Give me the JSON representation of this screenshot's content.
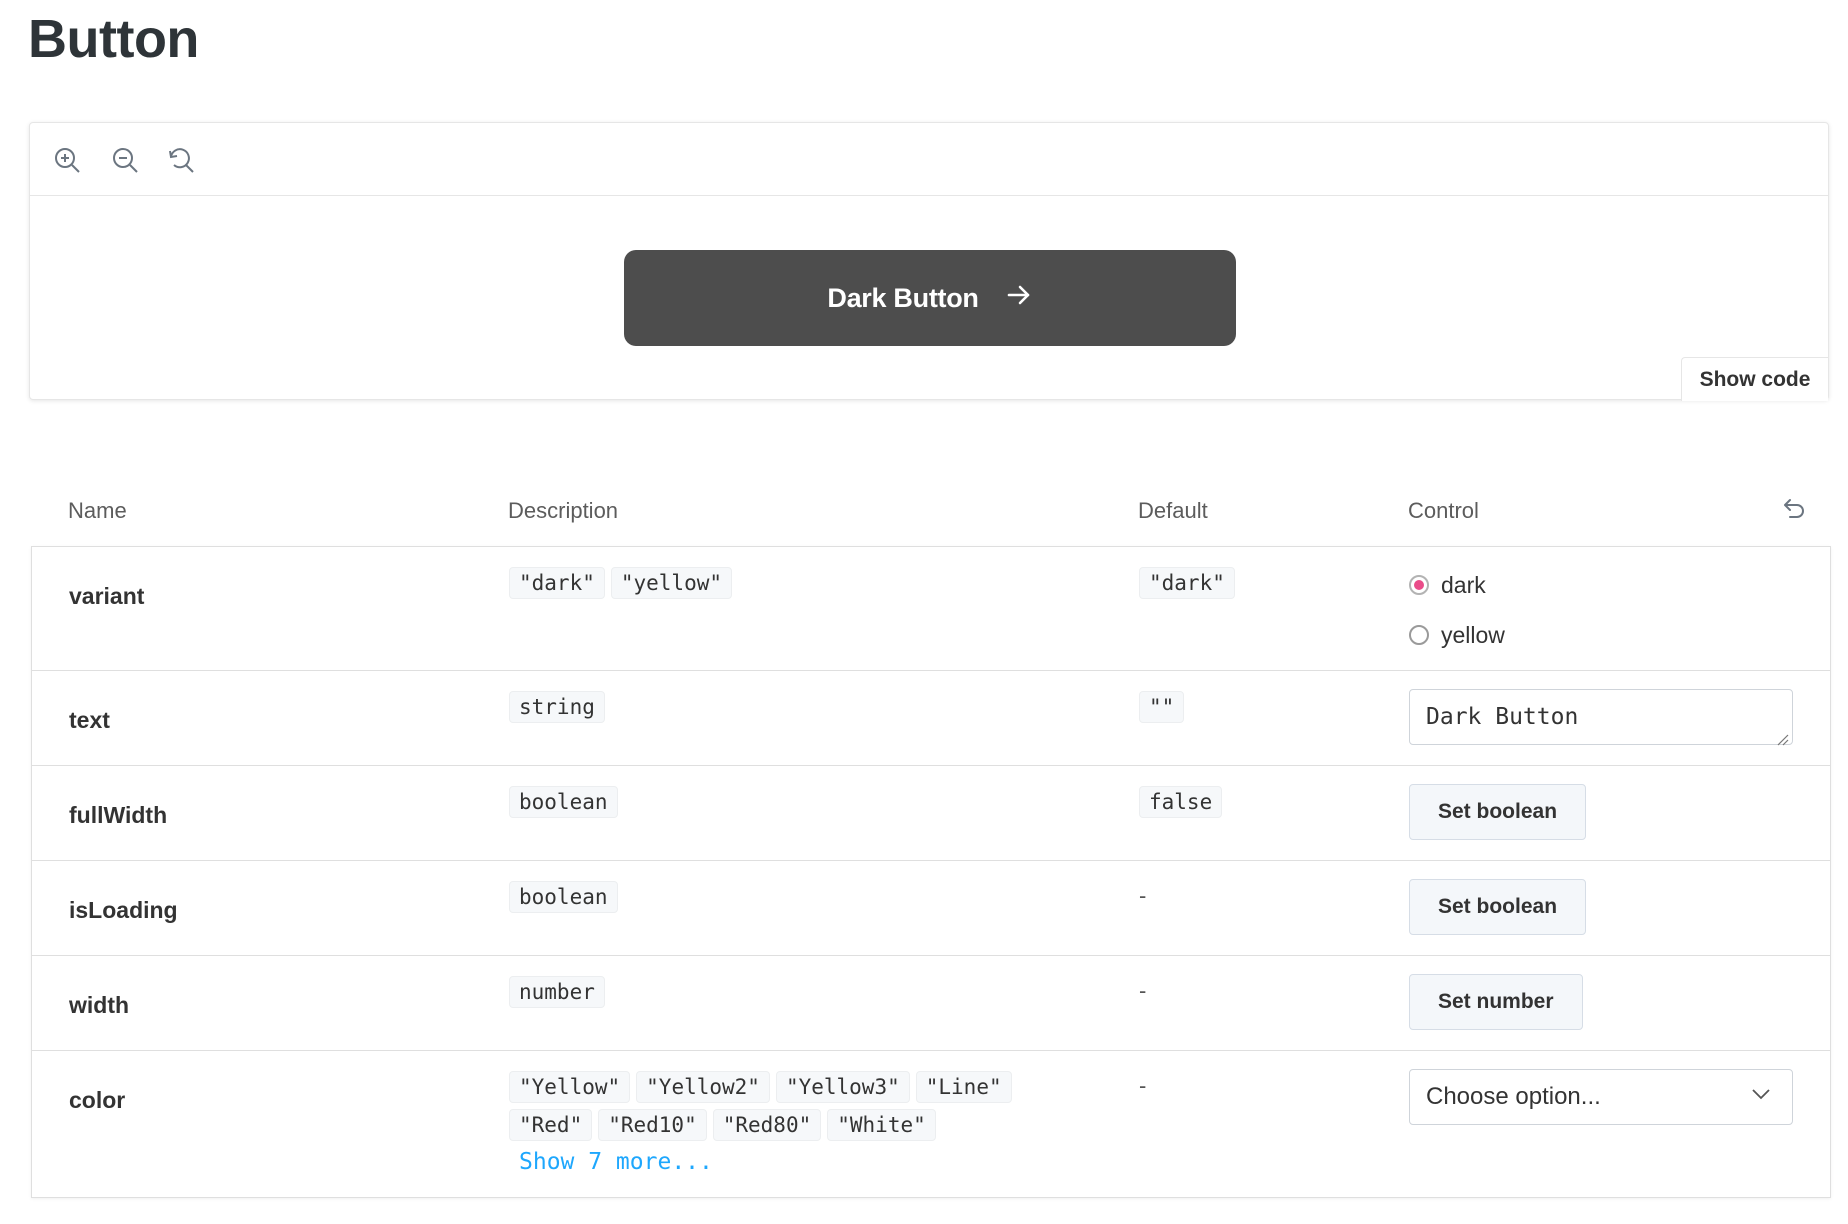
{
  "page": {
    "title": "Button"
  },
  "toolbar": {
    "icons": [
      "zoom-in-icon",
      "zoom-out-icon",
      "zoom-reset-icon"
    ]
  },
  "preview": {
    "button_label": "Dark Button",
    "button_icon": "arrow-right-icon",
    "button_color": "#4d4d4d",
    "show_code_label": "Show code"
  },
  "table": {
    "headers": {
      "name": "Name",
      "description": "Description",
      "default": "Default",
      "control": "Control"
    },
    "reset_icon": "undo-icon",
    "rows": [
      {
        "name": "variant",
        "description": [
          "\"dark\"",
          "\"yellow\""
        ],
        "default": "\"dark\"",
        "control": {
          "type": "radio",
          "options": [
            "dark",
            "yellow"
          ],
          "selected": "dark"
        }
      },
      {
        "name": "text",
        "description": [
          "string"
        ],
        "default": "\"\"",
        "control": {
          "type": "text",
          "value": "Dark Button"
        }
      },
      {
        "name": "fullWidth",
        "description": [
          "boolean"
        ],
        "default": "false",
        "control": {
          "type": "button",
          "label": "Set boolean"
        }
      },
      {
        "name": "isLoading",
        "description": [
          "boolean"
        ],
        "default": "-",
        "control": {
          "type": "button",
          "label": "Set boolean"
        }
      },
      {
        "name": "width",
        "description": [
          "number"
        ],
        "default": "-",
        "control": {
          "type": "button",
          "label": "Set number"
        }
      },
      {
        "name": "color",
        "description": [
          "\"Yellow\"",
          "\"Yellow2\"",
          "\"Yellow3\"",
          "\"Line\"",
          "\"Red\"",
          "\"Red10\"",
          "\"Red80\"",
          "\"White\""
        ],
        "show_more": "Show 7 more...",
        "default": "-",
        "control": {
          "type": "select",
          "placeholder": "Choose option...",
          "icon": "chevron-down-icon"
        }
      }
    ]
  },
  "colors": {
    "accent_radio": "#ea4c89",
    "link": "#1ea7fd"
  }
}
